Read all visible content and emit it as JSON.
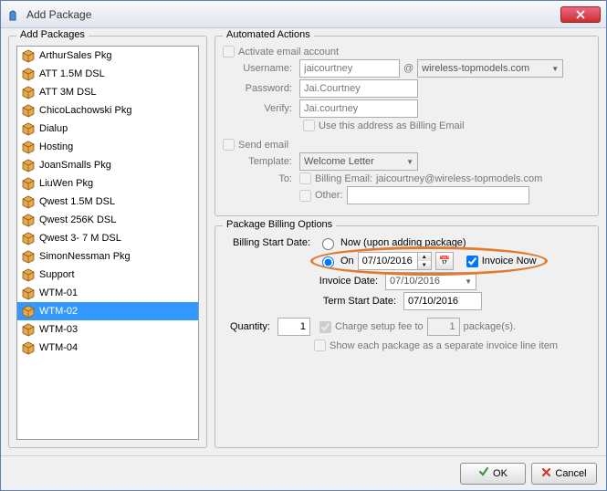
{
  "window": {
    "title": "Add Package"
  },
  "packages": {
    "legend": "Add Packages",
    "items": [
      "ArthurSales Pkg",
      "ATT 1.5M DSL",
      "ATT 3M DSL",
      "ChicoLachowski Pkg",
      "Dialup",
      "Hosting",
      "JoanSmalls Pkg",
      "LiuWen Pkg",
      "Qwest 1.5M DSL",
      "Qwest 256K DSL",
      "Qwest 3- 7 M DSL",
      "SimonNessman Pkg",
      "Support",
      "WTM-01",
      "WTM-02",
      "WTM-03",
      "WTM-04"
    ],
    "selected_index": 14
  },
  "automated": {
    "legend": "Automated Actions",
    "activate_label": "Activate email account",
    "username_label": "Username:",
    "username_value": "jaicourtney",
    "at": "@",
    "domain_value": "wireless-topmodels.com",
    "password_label": "Password:",
    "password_value": "Jai.Courtney",
    "verify_label": "Verify:",
    "verify_value": "Jai.courtney",
    "use_billing_label": "Use this address as Billing Email",
    "send_email_label": "Send email",
    "template_label": "Template:",
    "template_value": "Welcome Letter",
    "to_label": "To:",
    "billing_email_label": "Billing Email:",
    "billing_email_value": "jaicourtney@wireless-topmodels.com",
    "other_label": "Other:"
  },
  "billing": {
    "legend": "Package Billing Options",
    "start_date_label": "Billing Start Date:",
    "now_label": "Now (upon adding package)",
    "on_label": "On",
    "on_date": "07/10/2016",
    "invoice_now_label": "Invoice Now",
    "invoice_date_label": "Invoice Date:",
    "invoice_date_value": "07/10/2016",
    "term_start_label": "Term Start Date:",
    "term_start_value": "07/10/2016",
    "quantity_label": "Quantity:",
    "quantity_value": "1",
    "charge_setup_label_pre": "Charge setup fee to",
    "charge_setup_count": "1",
    "charge_setup_label_post": "package(s).",
    "show_each_label": "Show each package as a separate invoice line item"
  },
  "footer": {
    "ok": "OK",
    "cancel": "Cancel"
  }
}
